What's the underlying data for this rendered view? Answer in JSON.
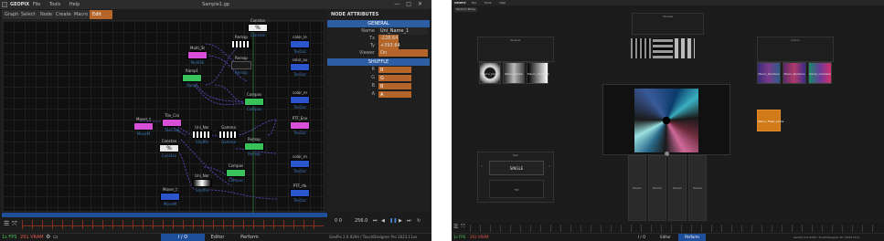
{
  "app_name": "GEOPIX",
  "menu": [
    "File",
    "Tools",
    "Help"
  ],
  "window_title": "Sample1.gp",
  "window_controls": [
    "—",
    "□",
    "✕"
  ],
  "tabs": [
    {
      "label": "Graph",
      "active": false
    },
    {
      "label": "Select",
      "active": false
    },
    {
      "label": "Node",
      "active": false
    },
    {
      "label": "Create",
      "active": false
    },
    {
      "label": "Macro",
      "active": false
    },
    {
      "label": "Edit MACRO",
      "active": true
    }
  ],
  "nodes": [
    {
      "title": "Constan",
      "sub": "Constan",
      "color": "#f0f0f0",
      "glyph": "%"
    },
    {
      "title": "Remap",
      "sub": "",
      "color": "#f0f0f0",
      "glyph": ""
    },
    {
      "title": "color_le",
      "sub": "TexOut",
      "color": "#2a55cc",
      "glyph": ""
    },
    {
      "title": "Multi_St",
      "sub": "MultiSh",
      "color": "#d84fd8",
      "glyph": ""
    },
    {
      "title": "Remap",
      "sub": "Remap",
      "color": "#1a1a1a",
      "glyph": ""
    },
    {
      "title": "color_ou",
      "sub": "TexOut",
      "color": "#2a55cc",
      "glyph": ""
    },
    {
      "title": "Ramp1",
      "sub": "Ramp",
      "color": "#39c15a",
      "glyph": ""
    },
    {
      "title": "Compos",
      "sub": "Compos",
      "color": "#39c15a",
      "glyph": ""
    },
    {
      "title": "color_m",
      "sub": "TexOut",
      "color": "#2a55cc",
      "glyph": ""
    },
    {
      "title": "Mover_t",
      "sub": "MoveM",
      "color": "#d84fd8",
      "glyph": ""
    },
    {
      "title": "Tile_Cro",
      "sub": "TileCrop",
      "color": "#d84fd8",
      "glyph": ""
    },
    {
      "title": "Uni_Nor",
      "sub": "Shuffle",
      "color": "#f0f0f0",
      "glyph": ""
    },
    {
      "title": "Gamma",
      "sub": "Gamma",
      "color": "#f0f0f0",
      "glyph": ""
    },
    {
      "title": "PTF_Env",
      "sub": "TexOut",
      "color": "#d84fd8",
      "glyph": ""
    },
    {
      "title": "Constan",
      "sub": "Constan",
      "color": "#e8e8e8",
      "glyph": "%"
    },
    {
      "title": "Remap",
      "sub": "Remap",
      "color": "#39c15a",
      "glyph": ""
    },
    {
      "title": "color_m",
      "sub": "TexOut",
      "color": "#2a55cc",
      "glyph": ""
    },
    {
      "title": "Compos",
      "sub": "Compos",
      "color": "#39c15a",
      "glyph": ""
    },
    {
      "title": "Uni_Nor",
      "sub": "Shuffle",
      "color": "#f0f0f0",
      "glyph": ""
    },
    {
      "title": "PTF_rtk",
      "sub": "TexOut",
      "color": "#2a55cc",
      "glyph": ""
    },
    {
      "title": "Mover_t",
      "sub": "MoveM",
      "color": "#2a55cc",
      "glyph": ""
    }
  ],
  "panel": {
    "header": "NODE ATTRIBUTES",
    "general_label": "GENERAL",
    "name_label": "Name",
    "name_value": "Uni_Name_1",
    "tx_label": "Tx",
    "tx_value": "-228.64",
    "ty_label": "Ty",
    "ty_value": "+393.64",
    "viewer_label": "Viewer",
    "viewer_value": "On",
    "shuffle_label": "SHUFFLE",
    "channels": [
      {
        "label": "R",
        "value": "R"
      },
      {
        "label": "G",
        "value": "G"
      },
      {
        "label": "B",
        "value": "B"
      },
      {
        "label": "A",
        "value": "A"
      }
    ]
  },
  "timeline": {
    "frame": "0 0",
    "fps": "256.0"
  },
  "status": {
    "fps_text": "1s FPS",
    "memory_text": "291 VRAM",
    "modes": [
      "I / O",
      "Editor",
      "Perform"
    ],
    "version": "GeoPix 2.0.9294 / TouchDesigner Pro 2023.11xx"
  },
  "perform": {
    "small_tab": "Perform Mode",
    "top_label": "Strobes",
    "left_panel_label": "Shapes",
    "right_panel_label": "Colors",
    "shapes": [
      "Macro_Circle",
      "Macro_Radial",
      "Macro_Gradient"
    ],
    "colors": [
      "Macro_Rainbow",
      "Macro_Rainbow",
      "Ramp_Gradient"
    ],
    "preset_label": "Macro_Flash_Circle",
    "spin_label": "Spin",
    "spin_value": "SINGLE",
    "speed_label": "Tilt",
    "sliders": [
      "Param",
      "Param",
      "Param",
      "Param"
    ],
    "modes": [
      "I / O",
      "Editor",
      "Perform"
    ],
    "version": "GeoPix 2.0.9294 / TouchDesigner Pro 2023.11xx"
  }
}
